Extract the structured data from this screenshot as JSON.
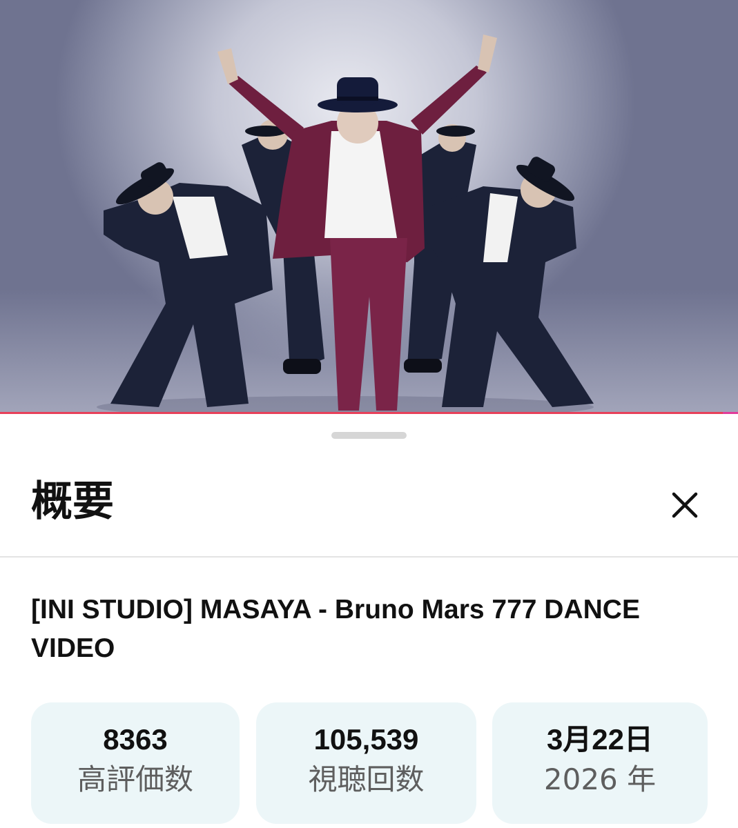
{
  "video": {
    "progress_fraction": 0.98
  },
  "sheet": {
    "title": "概要",
    "close_icon": "close-icon"
  },
  "details": {
    "video_title": "[INI STUDIO] MASAYA - Bruno Mars 777 DANCE VIDEO",
    "stats": [
      {
        "value": "8363",
        "label": "高評価数"
      },
      {
        "value": "105,539",
        "label": "視聴回数"
      },
      {
        "value": "3月22日",
        "label": "2026 年"
      }
    ]
  },
  "colors": {
    "progress_bar": "#e8405a",
    "stat_card_bg": "#ecf6f8",
    "lead_suit": "#6e1f3f",
    "backup_suit": "#1c2238"
  }
}
